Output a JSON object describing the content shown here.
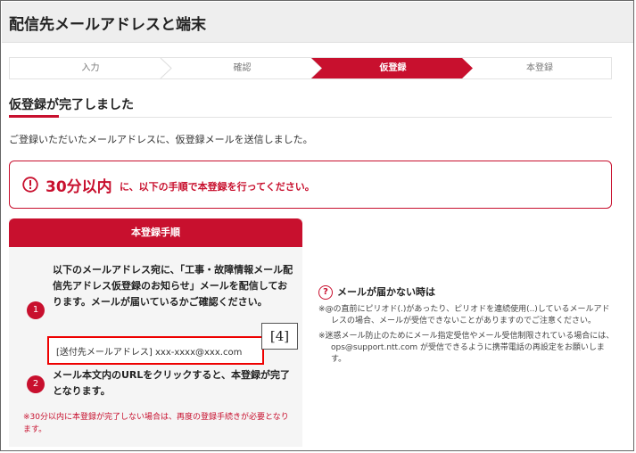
{
  "header": {
    "title": "配信先メールアドレスと端末"
  },
  "steps": [
    {
      "label": "入力",
      "active": false
    },
    {
      "label": "確認",
      "active": false
    },
    {
      "label": "仮登録",
      "active": true
    },
    {
      "label": "本登録",
      "active": false
    }
  ],
  "colors": {
    "accent": "#c8102e",
    "highlight_border": "#ee0000"
  },
  "section": {
    "title": "仮登録が完了しました"
  },
  "intro": "ご登録いただいたメールアドレスに、仮登録メールを送信しました。",
  "notice": {
    "icon": "exclamation-circle-icon",
    "emphasis": "30分以内",
    "rest": "に、以下の手順で本登録を行ってください。"
  },
  "procedure": {
    "header": "本登録手順",
    "step1_number": "1",
    "step1_text": "以下のメールアドレス宛に、「工事・故障情報メール配信先アドレス仮登録のお知らせ」メールを配信しております。メールが届いているかご確認ください。",
    "address": "[送付先メールアドレス] xxx-xxxx@xxx.com",
    "callout": "[4]",
    "step2_number": "2",
    "step2_text": "メール本文内のURLをクリックすると、本登録が完了となります。",
    "warning": "※30分以内に本登録が完了しない場合は、再度の登録手続きが必要となります。"
  },
  "help": {
    "icon": "question-circle-icon",
    "icon_glyph": "?",
    "title": "メールが届かない時は",
    "items": [
      "※@の直前にピリオド(.)があったり、ピリオドを連続使用(..)しているメールアドレスの場合、メールが受信できないことがありますのでご注意ください。",
      "※迷惑メール防止のためにメール指定受信やメール受信制限されている場合には、ops@support.ntt.com が受信できるように携帯電話の再設定をお願いします。"
    ]
  }
}
